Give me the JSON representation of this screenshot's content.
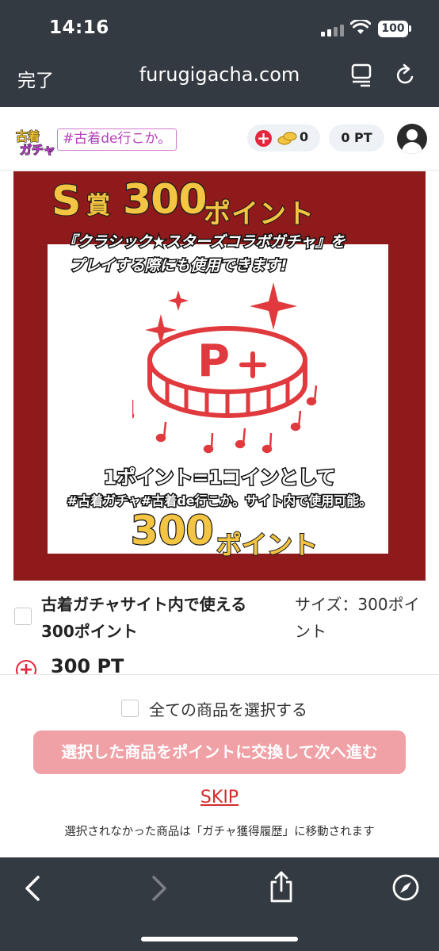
{
  "status_bar": {
    "time": "14:16",
    "battery": "100"
  },
  "browser": {
    "done_label": "完了",
    "url": "furugigacha.com"
  },
  "site_header": {
    "logo_text": "古着ガチャ",
    "logo_tag": "#古着de行こか。",
    "coin_count": "0",
    "points": "0 PT"
  },
  "prize": {
    "title_s": "S",
    "title_prize": "賞",
    "title_number": "300",
    "title_word": "ポイント",
    "promo_line1": "『クラシック★スターズコラボガチャ』を",
    "promo_line2": "プレイする際にも使用できます!",
    "coin_letter": "P",
    "bottom_line1": "1ポイント=1コインとして",
    "bottom_line2": "#古着ガチャ#古着de行こか。サイト内で使用可能。",
    "bottom_number": "300",
    "bottom_word": "ポイント",
    "colors": {
      "frame": "#8f1a1b",
      "gold": "#f4c542",
      "red": "#e03a3e"
    }
  },
  "item": {
    "name": "古着ガチャサイト内で使える300ポイント",
    "size": "サイズ：300ポイント",
    "points": "300 PT"
  },
  "actions": {
    "select_all": "全ての商品を選択する",
    "exchange_button": "選択した商品をポイントに交換して次へ進む",
    "skip": "SKIP",
    "note": "選択されなかった商品は「ガチャ獲得履歴」に移動されます"
  },
  "colors": {
    "chrome": "#343a42",
    "accent_red": "#d42c2c",
    "button_disabled": "#f0a1a6"
  }
}
